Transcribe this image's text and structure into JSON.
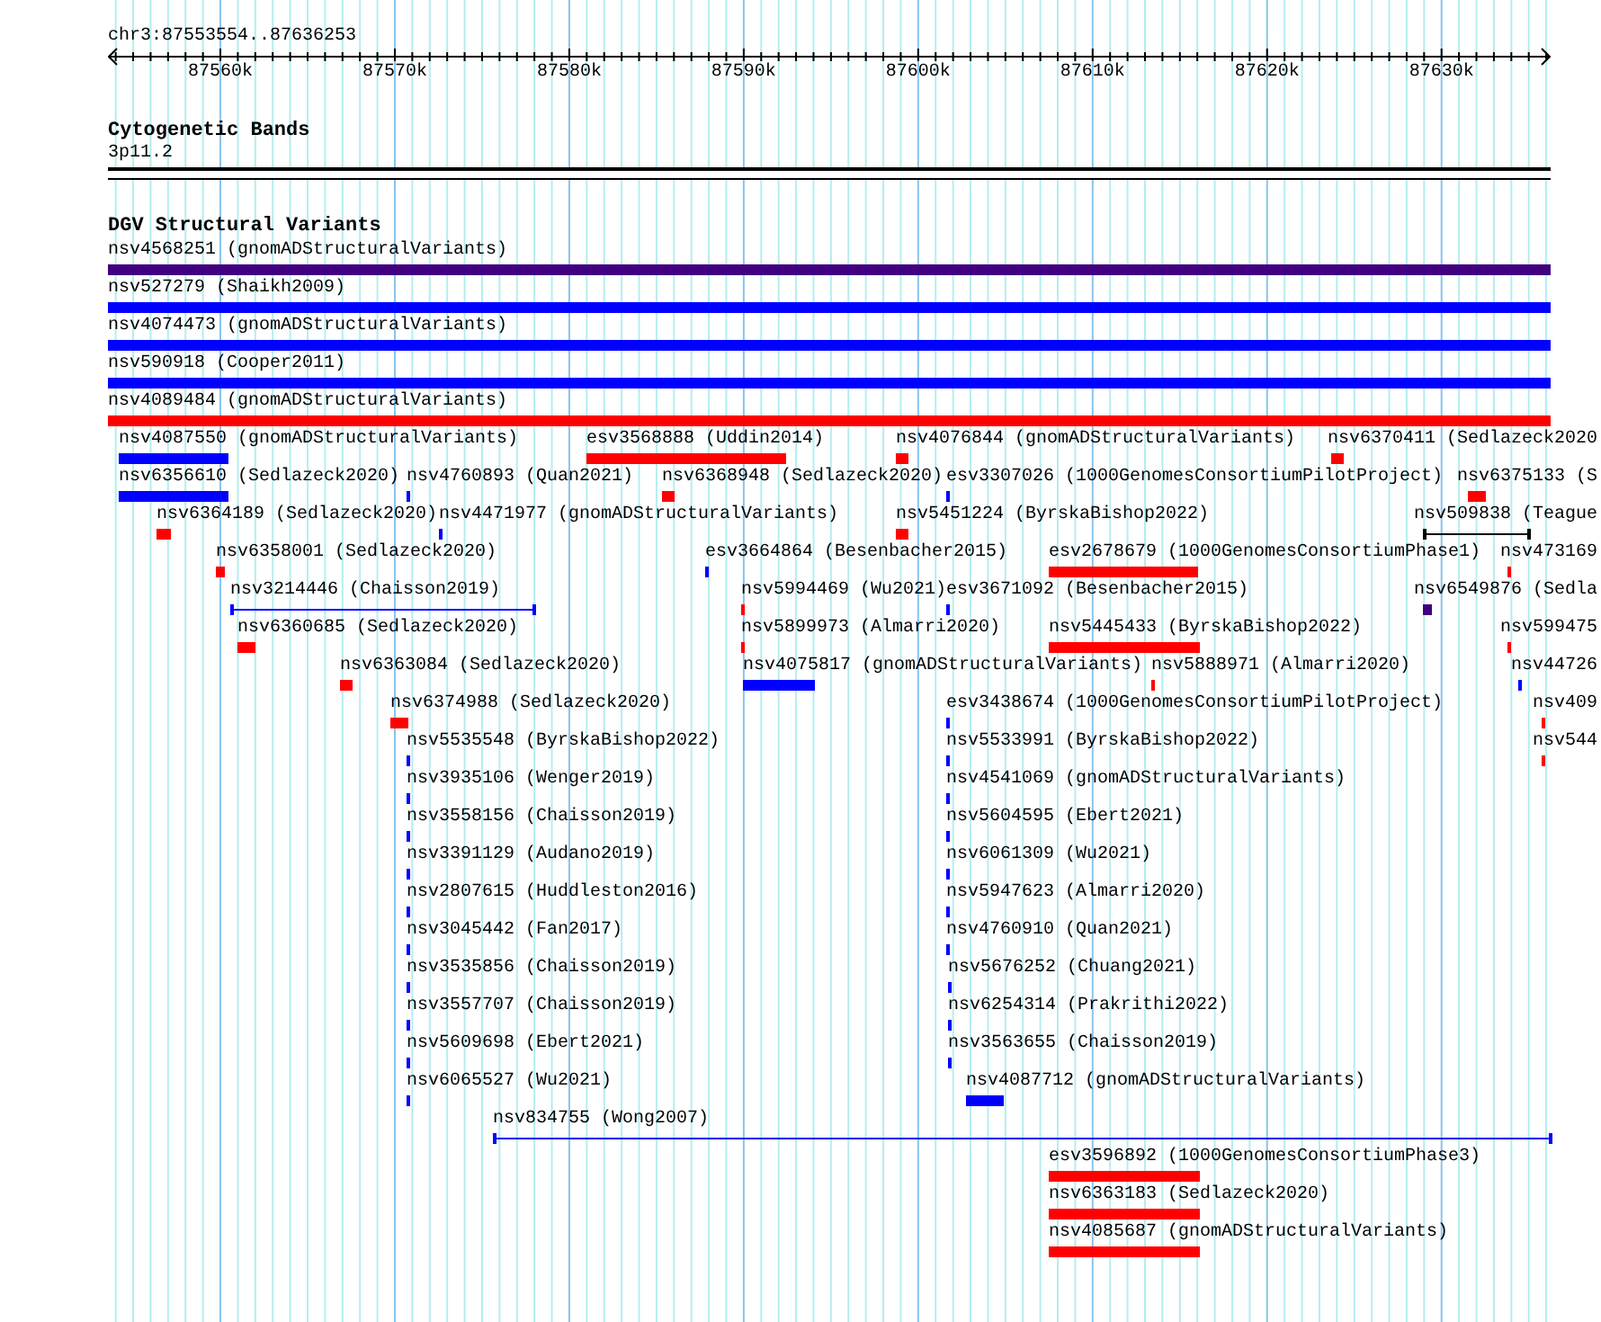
{
  "ruler": {
    "region": "chr3:87553554..87636253",
    "ticks": [
      "87560k",
      "87570k",
      "87580k",
      "87590k",
      "87600k",
      "87610k",
      "87620k",
      "87630k"
    ]
  },
  "cytogenetic_bands": {
    "title": "Cytogenetic Bands",
    "band": "3p11.2"
  },
  "dgv": {
    "title": "DGV Structural Variants",
    "features": [
      {
        "label": "nsv4568251 (gnomADStructuralVariants)",
        "color": "#400080",
        "kind": "bar"
      },
      {
        "label": "nsv527279 (Shaikh2009)",
        "color": "#0000ff",
        "kind": "bar"
      },
      {
        "label": "nsv4074473 (gnomADStructuralVariants)",
        "color": "#0000ff",
        "kind": "bar"
      },
      {
        "label": "nsv590918 (Cooper2011)",
        "color": "#0000ff",
        "kind": "bar"
      },
      {
        "label": "nsv4089484 (gnomADStructuralVariants)",
        "color": "#ff0000",
        "kind": "bar"
      },
      {
        "label": "nsv4087550 (gnomADStructuralVariants)",
        "color": "#0000ff",
        "kind": "bar"
      },
      {
        "label": "esv3568888 (Uddin2014)",
        "color": "#ff0000",
        "kind": "bar"
      },
      {
        "label": "nsv4076844 (gnomADStructuralVariants)",
        "color": "#ff0000",
        "kind": "bar"
      },
      {
        "label": "nsv6370411 (Sedlazeck2020",
        "color": "#ff0000",
        "kind": "bar"
      },
      {
        "label": "nsv6356610 (Sedlazeck2020)",
        "color": "#0000ff",
        "kind": "bar"
      },
      {
        "label": "nsv4760893 (Quan2021)",
        "color": "#0000ff",
        "kind": "bar"
      },
      {
        "label": "nsv6368948 (Sedlazeck2020)",
        "color": "#ff0000",
        "kind": "bar"
      },
      {
        "label": "esv3307026 (1000GenomesConsortiumPilotProject)",
        "color": "#0000ff",
        "kind": "bar"
      },
      {
        "label": "nsv6375133 (S",
        "color": "#ff0000",
        "kind": "bar"
      },
      {
        "label": "nsv6364189 (Sedlazeck2020)",
        "color": "#ff0000",
        "kind": "bar"
      },
      {
        "label": "nsv4471977 (gnomADStructuralVariants)",
        "color": "#0000ff",
        "kind": "bar"
      },
      {
        "label": "nsv5451224 (ByrskaBishop2022)",
        "color": "#ff0000",
        "kind": "bar"
      },
      {
        "label": "nsv509838 (Teague",
        "color": "#000000",
        "kind": "span"
      },
      {
        "label": "nsv6358001 (Sedlazeck2020)",
        "color": "#ff0000",
        "kind": "bar"
      },
      {
        "label": "esv3664864 (Besenbacher2015)",
        "color": "#0000ff",
        "kind": "bar"
      },
      {
        "label": "esv2678679 (1000GenomesConsortiumPhase1)",
        "color": "#ff0000",
        "kind": "bar"
      },
      {
        "label": "nsv473169",
        "color": "#ff0000",
        "kind": "bar"
      },
      {
        "label": "nsv3214446 (Chaisson2019)",
        "color": "#0000ff",
        "kind": "span"
      },
      {
        "label": "nsv5994469 (Wu2021)",
        "color": "#ff0000",
        "kind": "bar"
      },
      {
        "label": "esv3671092 (Besenbacher2015)",
        "color": "#0000ff",
        "kind": "bar"
      },
      {
        "label": "nsv6549876 (Sedla",
        "color": "#400080",
        "kind": "bar"
      },
      {
        "label": "nsv6360685 (Sedlazeck2020)",
        "color": "#ff0000",
        "kind": "bar"
      },
      {
        "label": "nsv5899973 (Almarri2020)",
        "color": "#ff0000",
        "kind": "bar"
      },
      {
        "label": "nsv5445433 (ByrskaBishop2022)",
        "color": "#ff0000",
        "kind": "bar"
      },
      {
        "label": "nsv599475",
        "color": "#ff0000",
        "kind": "bar"
      },
      {
        "label": "nsv6363084 (Sedlazeck2020)",
        "color": "#ff0000",
        "kind": "bar"
      },
      {
        "label": "nsv4075817 (gnomADStructuralVariants)",
        "color": "#0000ff",
        "kind": "bar"
      },
      {
        "label": "nsv5888971 (Almarri2020)",
        "color": "#ff0000",
        "kind": "bar"
      },
      {
        "label": "nsv44726",
        "color": "#0000ff",
        "kind": "bar"
      },
      {
        "label": "nsv6374988 (Sedlazeck2020)",
        "color": "#ff0000",
        "kind": "bar"
      },
      {
        "label": "esv3438674 (1000GenomesConsortiumPilotProject)",
        "color": "#0000ff",
        "kind": "bar"
      },
      {
        "label": "nsv409",
        "color": "#ff0000",
        "kind": "bar"
      },
      {
        "label": "nsv5535548 (ByrskaBishop2022)",
        "color": "#0000ff",
        "kind": "bar"
      },
      {
        "label": "nsv5533991 (ByrskaBishop2022)",
        "color": "#0000ff",
        "kind": "bar"
      },
      {
        "label": "nsv544",
        "color": "#ff0000",
        "kind": "bar"
      },
      {
        "label": "nsv3935106 (Wenger2019)",
        "color": "#0000ff",
        "kind": "bar"
      },
      {
        "label": "nsv4541069 (gnomADStructuralVariants)",
        "color": "#0000ff",
        "kind": "bar"
      },
      {
        "label": "nsv3558156 (Chaisson2019)",
        "color": "#0000ff",
        "kind": "bar"
      },
      {
        "label": "nsv5604595 (Ebert2021)",
        "color": "#0000ff",
        "kind": "bar"
      },
      {
        "label": "nsv3391129 (Audano2019)",
        "color": "#0000ff",
        "kind": "bar"
      },
      {
        "label": "nsv6061309 (Wu2021)",
        "color": "#0000ff",
        "kind": "bar"
      },
      {
        "label": "nsv2807615 (Huddleston2016)",
        "color": "#0000ff",
        "kind": "bar"
      },
      {
        "label": "nsv5947623 (Almarri2020)",
        "color": "#0000ff",
        "kind": "bar"
      },
      {
        "label": "nsv3045442 (Fan2017)",
        "color": "#0000ff",
        "kind": "bar"
      },
      {
        "label": "nsv4760910 (Quan2021)",
        "color": "#0000ff",
        "kind": "bar"
      },
      {
        "label": "nsv3535856 (Chaisson2019)",
        "color": "#0000ff",
        "kind": "bar"
      },
      {
        "label": "nsv5676252 (Chuang2021)",
        "color": "#0000ff",
        "kind": "bar"
      },
      {
        "label": "nsv3557707 (Chaisson2019)",
        "color": "#0000ff",
        "kind": "bar"
      },
      {
        "label": "nsv6254314 (Prakrithi2022)",
        "color": "#0000ff",
        "kind": "bar"
      },
      {
        "label": "nsv5609698 (Ebert2021)",
        "color": "#0000ff",
        "kind": "bar"
      },
      {
        "label": "nsv3563655 (Chaisson2019)",
        "color": "#0000ff",
        "kind": "bar"
      },
      {
        "label": "nsv6065527 (Wu2021)",
        "color": "#0000ff",
        "kind": "bar"
      },
      {
        "label": "nsv4087712 (gnomADStructuralVariants)",
        "color": "#0000ff",
        "kind": "bar"
      },
      {
        "label": "nsv834755 (Wong2007)",
        "color": "#0000ff",
        "kind": "span"
      },
      {
        "label": "esv3596892 (1000GenomesConsortiumPhase3)",
        "color": "#ff0000",
        "kind": "bar"
      },
      {
        "label": "nsv6363183 (Sedlazeck2020)",
        "color": "#ff0000",
        "kind": "bar"
      },
      {
        "label": "nsv4085687 (gnomADStructuralVariants)",
        "color": "#ff0000",
        "kind": "bar"
      }
    ]
  }
}
